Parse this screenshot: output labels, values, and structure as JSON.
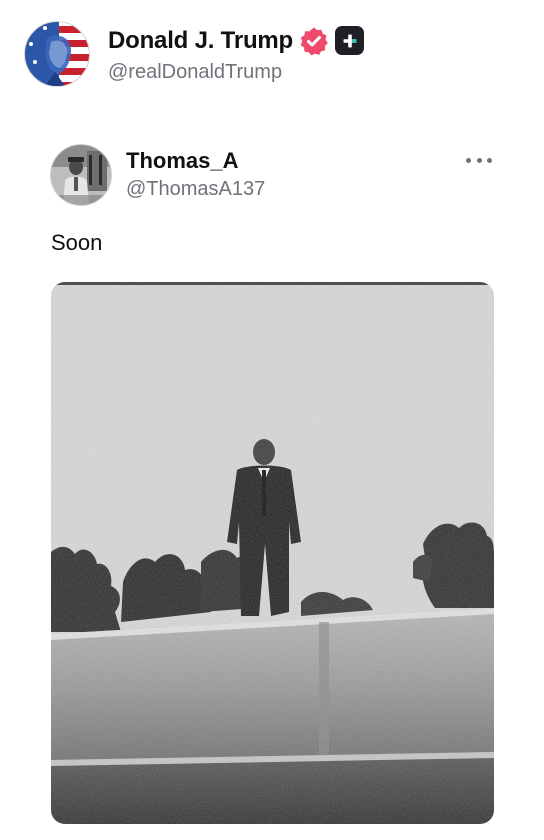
{
  "author": {
    "display_name": "Donald J. Trump",
    "handle": "@realDonaldTrump",
    "verified": true,
    "badge_color": "#ef4a6b"
  },
  "quoted_post": {
    "display_name": "Thomas_A",
    "handle": "@ThomasA137",
    "text": "Soon"
  },
  "icons": {
    "verified": "verified-badge-icon",
    "plus": "plus-badge-icon",
    "more": "more-horizontal-icon"
  }
}
